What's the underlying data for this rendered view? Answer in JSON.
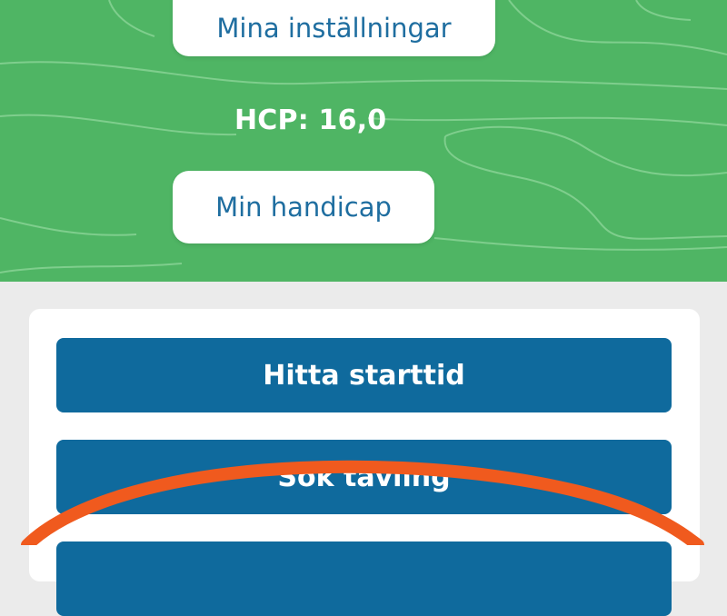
{
  "profile": {
    "settings_label": "Mina inställningar",
    "hcp_text": "HCP: 16,0",
    "handicap_label": "Min handicap"
  },
  "actions": {
    "find_tee_time_label": "Hitta starttid",
    "search_competition_label": "Sök tävling",
    "third_label": ""
  },
  "colors": {
    "hero_green": "#4fb564",
    "button_blue": "#0f6a9d",
    "pill_text_blue": "#1f6ea0",
    "annotation_orange": "#f05a1e"
  },
  "icons": {
    "background_pattern": "topographic-contour-lines",
    "annotation": "hand-drawn-orange-ellipse"
  }
}
